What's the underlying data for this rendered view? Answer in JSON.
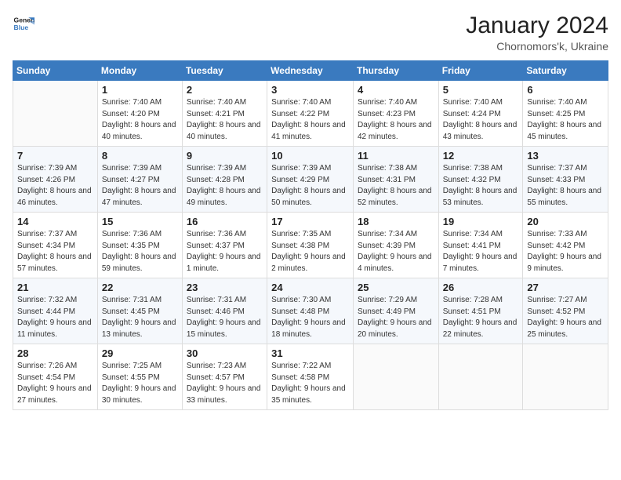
{
  "logo": {
    "line1": "General",
    "line2": "Blue"
  },
  "title": "January 2024",
  "subtitle": "Chornomors'k, Ukraine",
  "header_days": [
    "Sunday",
    "Monday",
    "Tuesday",
    "Wednesday",
    "Thursday",
    "Friday",
    "Saturday"
  ],
  "weeks": [
    [
      {
        "day": "",
        "sunrise": "",
        "sunset": "",
        "daylight": ""
      },
      {
        "day": "1",
        "sunrise": "Sunrise: 7:40 AM",
        "sunset": "Sunset: 4:20 PM",
        "daylight": "Daylight: 8 hours and 40 minutes."
      },
      {
        "day": "2",
        "sunrise": "Sunrise: 7:40 AM",
        "sunset": "Sunset: 4:21 PM",
        "daylight": "Daylight: 8 hours and 40 minutes."
      },
      {
        "day": "3",
        "sunrise": "Sunrise: 7:40 AM",
        "sunset": "Sunset: 4:22 PM",
        "daylight": "Daylight: 8 hours and 41 minutes."
      },
      {
        "day": "4",
        "sunrise": "Sunrise: 7:40 AM",
        "sunset": "Sunset: 4:23 PM",
        "daylight": "Daylight: 8 hours and 42 minutes."
      },
      {
        "day": "5",
        "sunrise": "Sunrise: 7:40 AM",
        "sunset": "Sunset: 4:24 PM",
        "daylight": "Daylight: 8 hours and 43 minutes."
      },
      {
        "day": "6",
        "sunrise": "Sunrise: 7:40 AM",
        "sunset": "Sunset: 4:25 PM",
        "daylight": "Daylight: 8 hours and 45 minutes."
      }
    ],
    [
      {
        "day": "7",
        "sunrise": "Sunrise: 7:39 AM",
        "sunset": "Sunset: 4:26 PM",
        "daylight": "Daylight: 8 hours and 46 minutes."
      },
      {
        "day": "8",
        "sunrise": "Sunrise: 7:39 AM",
        "sunset": "Sunset: 4:27 PM",
        "daylight": "Daylight: 8 hours and 47 minutes."
      },
      {
        "day": "9",
        "sunrise": "Sunrise: 7:39 AM",
        "sunset": "Sunset: 4:28 PM",
        "daylight": "Daylight: 8 hours and 49 minutes."
      },
      {
        "day": "10",
        "sunrise": "Sunrise: 7:39 AM",
        "sunset": "Sunset: 4:29 PM",
        "daylight": "Daylight: 8 hours and 50 minutes."
      },
      {
        "day": "11",
        "sunrise": "Sunrise: 7:38 AM",
        "sunset": "Sunset: 4:31 PM",
        "daylight": "Daylight: 8 hours and 52 minutes."
      },
      {
        "day": "12",
        "sunrise": "Sunrise: 7:38 AM",
        "sunset": "Sunset: 4:32 PM",
        "daylight": "Daylight: 8 hours and 53 minutes."
      },
      {
        "day": "13",
        "sunrise": "Sunrise: 7:37 AM",
        "sunset": "Sunset: 4:33 PM",
        "daylight": "Daylight: 8 hours and 55 minutes."
      }
    ],
    [
      {
        "day": "14",
        "sunrise": "Sunrise: 7:37 AM",
        "sunset": "Sunset: 4:34 PM",
        "daylight": "Daylight: 8 hours and 57 minutes."
      },
      {
        "day": "15",
        "sunrise": "Sunrise: 7:36 AM",
        "sunset": "Sunset: 4:35 PM",
        "daylight": "Daylight: 8 hours and 59 minutes."
      },
      {
        "day": "16",
        "sunrise": "Sunrise: 7:36 AM",
        "sunset": "Sunset: 4:37 PM",
        "daylight": "Daylight: 9 hours and 1 minute."
      },
      {
        "day": "17",
        "sunrise": "Sunrise: 7:35 AM",
        "sunset": "Sunset: 4:38 PM",
        "daylight": "Daylight: 9 hours and 2 minutes."
      },
      {
        "day": "18",
        "sunrise": "Sunrise: 7:34 AM",
        "sunset": "Sunset: 4:39 PM",
        "daylight": "Daylight: 9 hours and 4 minutes."
      },
      {
        "day": "19",
        "sunrise": "Sunrise: 7:34 AM",
        "sunset": "Sunset: 4:41 PM",
        "daylight": "Daylight: 9 hours and 7 minutes."
      },
      {
        "day": "20",
        "sunrise": "Sunrise: 7:33 AM",
        "sunset": "Sunset: 4:42 PM",
        "daylight": "Daylight: 9 hours and 9 minutes."
      }
    ],
    [
      {
        "day": "21",
        "sunrise": "Sunrise: 7:32 AM",
        "sunset": "Sunset: 4:44 PM",
        "daylight": "Daylight: 9 hours and 11 minutes."
      },
      {
        "day": "22",
        "sunrise": "Sunrise: 7:31 AM",
        "sunset": "Sunset: 4:45 PM",
        "daylight": "Daylight: 9 hours and 13 minutes."
      },
      {
        "day": "23",
        "sunrise": "Sunrise: 7:31 AM",
        "sunset": "Sunset: 4:46 PM",
        "daylight": "Daylight: 9 hours and 15 minutes."
      },
      {
        "day": "24",
        "sunrise": "Sunrise: 7:30 AM",
        "sunset": "Sunset: 4:48 PM",
        "daylight": "Daylight: 9 hours and 18 minutes."
      },
      {
        "day": "25",
        "sunrise": "Sunrise: 7:29 AM",
        "sunset": "Sunset: 4:49 PM",
        "daylight": "Daylight: 9 hours and 20 minutes."
      },
      {
        "day": "26",
        "sunrise": "Sunrise: 7:28 AM",
        "sunset": "Sunset: 4:51 PM",
        "daylight": "Daylight: 9 hours and 22 minutes."
      },
      {
        "day": "27",
        "sunrise": "Sunrise: 7:27 AM",
        "sunset": "Sunset: 4:52 PM",
        "daylight": "Daylight: 9 hours and 25 minutes."
      }
    ],
    [
      {
        "day": "28",
        "sunrise": "Sunrise: 7:26 AM",
        "sunset": "Sunset: 4:54 PM",
        "daylight": "Daylight: 9 hours and 27 minutes."
      },
      {
        "day": "29",
        "sunrise": "Sunrise: 7:25 AM",
        "sunset": "Sunset: 4:55 PM",
        "daylight": "Daylight: 9 hours and 30 minutes."
      },
      {
        "day": "30",
        "sunrise": "Sunrise: 7:23 AM",
        "sunset": "Sunset: 4:57 PM",
        "daylight": "Daylight: 9 hours and 33 minutes."
      },
      {
        "day": "31",
        "sunrise": "Sunrise: 7:22 AM",
        "sunset": "Sunset: 4:58 PM",
        "daylight": "Daylight: 9 hours and 35 minutes."
      },
      {
        "day": "",
        "sunrise": "",
        "sunset": "",
        "daylight": ""
      },
      {
        "day": "",
        "sunrise": "",
        "sunset": "",
        "daylight": ""
      },
      {
        "day": "",
        "sunrise": "",
        "sunset": "",
        "daylight": ""
      }
    ]
  ]
}
